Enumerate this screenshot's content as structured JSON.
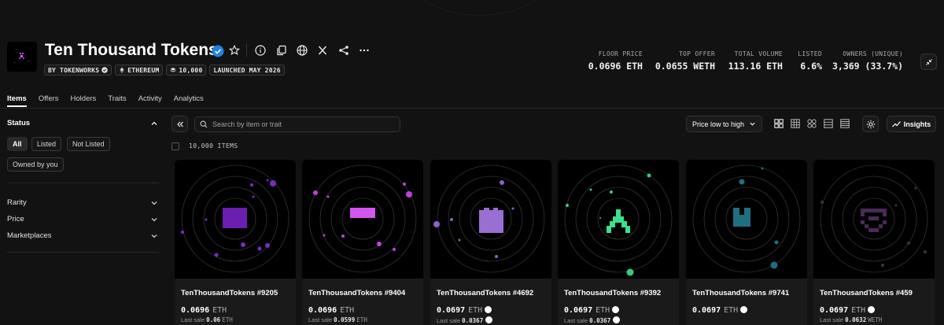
{
  "collection": {
    "title": "Ten Thousand Tokens",
    "chips": [
      {
        "label": "BY TOKENWORKS",
        "icon": "verified-icon"
      },
      {
        "label": "ETHEREUM",
        "icon": "ethereum-icon"
      },
      {
        "label": "10,000",
        "icon": "layers-icon"
      },
      {
        "label": "LAUNCHED MAY 2026",
        "icon": ""
      }
    ]
  },
  "stats": [
    {
      "label": "FLOOR PRICE",
      "value": "0.0696 ETH"
    },
    {
      "label": "TOP OFFER",
      "value": "0.0655 WETH"
    },
    {
      "label": "TOTAL VOLUME",
      "value": "113.16 ETH"
    },
    {
      "label": "LISTED",
      "value": "6.6%"
    },
    {
      "label": "OWNERS (UNIQUE)",
      "value": "3,369 (33.7%)"
    }
  ],
  "tabs": [
    "Items",
    "Offers",
    "Holders",
    "Traits",
    "Activity",
    "Analytics"
  ],
  "sidebar": {
    "status_title": "Status",
    "status_options": [
      "All",
      "Listed",
      "Not Listed",
      "Owned by you"
    ],
    "filters": [
      "Rarity",
      "Price",
      "Marketplaces"
    ]
  },
  "toolbar": {
    "search_placeholder": "Search by item or trait",
    "sort_label": "Price low to high",
    "insights_label": "Insights",
    "items_count": "10,000 ITEMS"
  },
  "cards": [
    {
      "name": "TenThousandTokens #9205",
      "price": "0.0696",
      "currency": "ETH",
      "sale_prefix": "Last sale",
      "sale_value": "0.06",
      "sale_currency": "ETH",
      "color": "#6a1fb0"
    },
    {
      "name": "TenThousandTokens #9404",
      "price": "0.0696",
      "currency": "ETH",
      "sale_prefix": "Last sale",
      "sale_value": "0.0599",
      "sale_currency": "ETH",
      "color": "#d455f0"
    },
    {
      "name": "TenThousandTokens #4692",
      "price": "0.0697",
      "currency": "ETH",
      "sale_prefix": "Last sale",
      "sale_value": "0.0367",
      "sale_currency": "",
      "color": "#9a6fd4"
    },
    {
      "name": "TenThousandTokens #9392",
      "price": "0.0697",
      "currency": "ETH",
      "sale_prefix": "Last sale",
      "sale_value": "0.0367",
      "sale_currency": "",
      "color": "#3ce08a"
    },
    {
      "name": "TenThousandTokens #9741",
      "price": "0.0697",
      "currency": "ETH",
      "sale_prefix": "",
      "sale_value": "",
      "sale_currency": "",
      "color": "#1f6f80"
    },
    {
      "name": "TenThousandTokens #459",
      "price": "0.0697",
      "currency": "ETH",
      "sale_prefix": "Last sale",
      "sale_value": "0.0632",
      "sale_currency": "WETH",
      "color": "#4a2a55"
    }
  ],
  "colors": {
    "background": "#121212",
    "card": "#1a1a1a",
    "verified": "#2081e2"
  }
}
